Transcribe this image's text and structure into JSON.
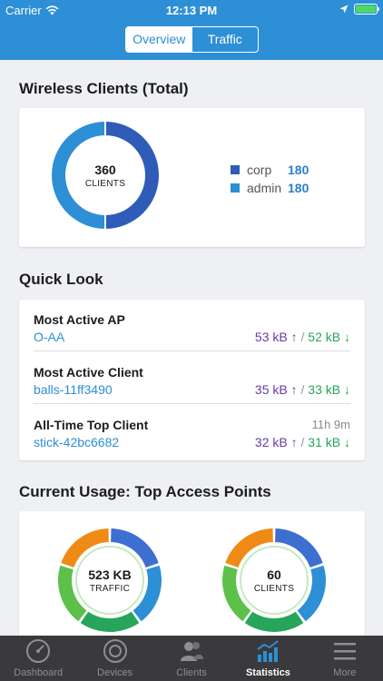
{
  "status_bar": {
    "carrier": "Carrier",
    "time": "12:13 PM"
  },
  "segments": {
    "overview": "Overview",
    "traffic": "Traffic"
  },
  "wireless": {
    "title": "Wireless Clients (Total)",
    "total": "360",
    "total_label": "CLIENTS",
    "legend": [
      {
        "name": "corp",
        "value": "180",
        "color": "#2e5cb8"
      },
      {
        "name": "admin",
        "value": "180",
        "color": "#2d8fd5"
      }
    ]
  },
  "quick_look": {
    "title": "Quick Look",
    "rows": [
      {
        "label": "Most Active AP",
        "link": "O-AA",
        "extra": "",
        "up": "53 kB ↑",
        "down": "52 kB ↓"
      },
      {
        "label": "Most Active Client",
        "link": "balls-11ff3490",
        "extra": "",
        "up": "35 kB ↑",
        "down": "33 kB ↓"
      },
      {
        "label": "All-Time Top Client",
        "link": "stick-42bc6682",
        "extra": "11h 9m",
        "up": "32 kB ↑",
        "down": "31 kB ↓"
      }
    ],
    "separator": " / "
  },
  "usage": {
    "title": "Current Usage: Top Access Points",
    "traffic_value": "523 KB",
    "traffic_label": "TRAFFIC",
    "clients_value": "60",
    "clients_label": "CLIENTS",
    "ring_colors": [
      "#3d6fd0",
      "#2d8fd5",
      "#27a55a",
      "#5cc04a",
      "#f08a17"
    ]
  },
  "tabs": [
    {
      "label": "Dashboard",
      "icon": "gauge-icon"
    },
    {
      "label": "Devices",
      "icon": "target-icon"
    },
    {
      "label": "Clients",
      "icon": "users-icon"
    },
    {
      "label": "Statistics",
      "icon": "chart-icon",
      "active": true
    },
    {
      "label": "More",
      "icon": "menu-icon"
    }
  ]
}
